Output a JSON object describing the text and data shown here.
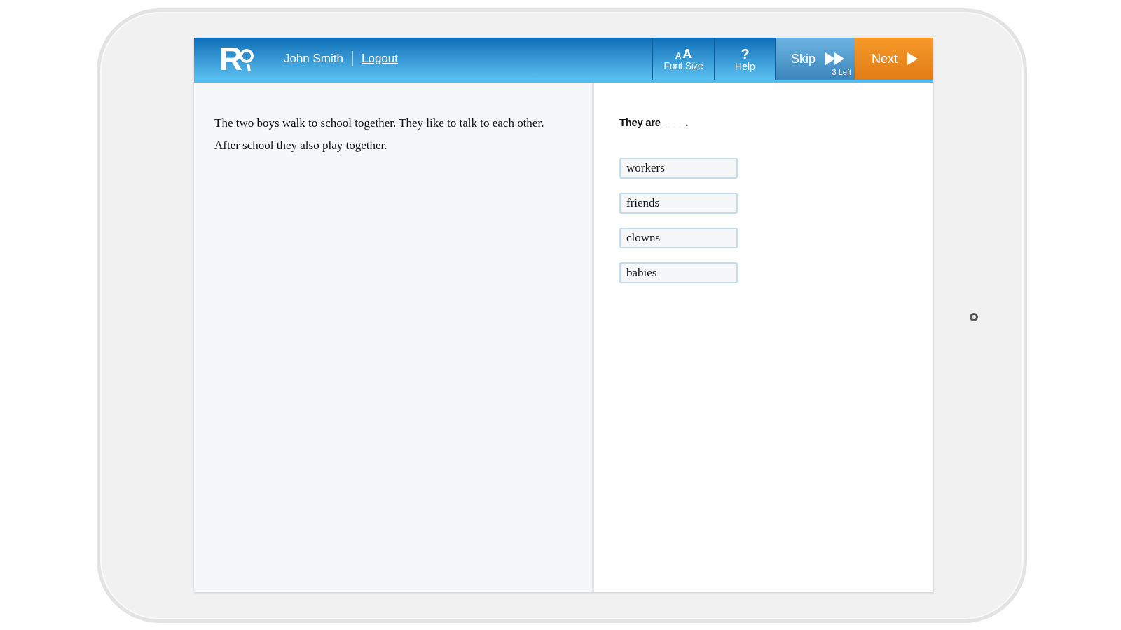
{
  "header": {
    "logo": "R",
    "user_name": "John Smith",
    "logout": "Logout",
    "font_size": {
      "glyphs": [
        "A",
        "A"
      ],
      "label": "Font Size"
    },
    "help": {
      "glyph": "?",
      "label": "Help"
    },
    "skip": {
      "label": "Skip",
      "remaining": "3 Left"
    },
    "next": {
      "label": "Next"
    }
  },
  "passage": "The two boys walk to school together. They like to talk to each other. After school they also play together.",
  "question": {
    "prompt": "They are ____.",
    "options": [
      {
        "label": "workers",
        "selected": false
      },
      {
        "label": "friends",
        "selected": false
      },
      {
        "label": "clowns",
        "selected": false
      },
      {
        "label": "babies",
        "selected": false
      }
    ]
  }
}
